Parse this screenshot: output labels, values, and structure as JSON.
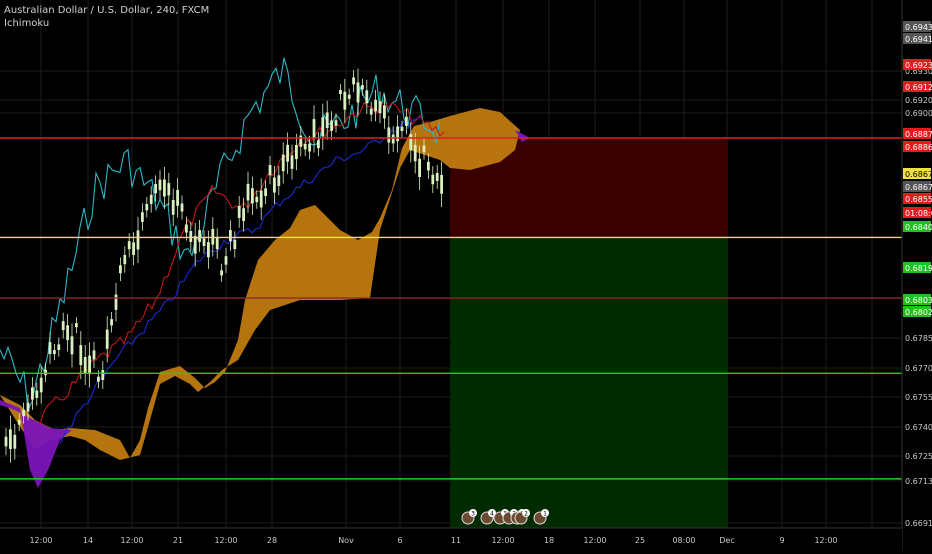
{
  "header": {
    "symbol_title": "Australian Dollar / U.S. Dollar, 240, FXCM",
    "indicator_label": "Ichimoku"
  },
  "colors": {
    "background": "#000000",
    "grid": "#1c1c1c",
    "text": "#c8c8c8",
    "candle": "#d8f0c0",
    "conversion_line": "#2ab8c8",
    "base_line": "#c01818",
    "lagging_span": "#1a2ad0",
    "cloud_bull": "#c07a10",
    "cloud_bear": "#7a14b8",
    "stop_zone": "#3a0000",
    "target_zone": "#002a00",
    "red_line": "#e02020",
    "yellow_line": "#f0e040",
    "dark_red_line": "#8a2a2a",
    "green_line": "#20d020"
  },
  "chart_data": {
    "type": "line",
    "title": "Australian Dollar / U.S. Dollar, 240, FXCM",
    "indicator": "Ichimoku",
    "x_tick_labels": [
      "12:00",
      "14",
      "12:00",
      "21",
      "12:00",
      "28",
      "Nov",
      "6",
      "11",
      "12:00",
      "18",
      "12:00",
      "25",
      "08:00",
      "Dec",
      "9",
      "12:00"
    ],
    "y_tick_labels": [
      "0.69300",
      "0.69200",
      "0.69000",
      "0.67850",
      "0.67700",
      "0.67550",
      "0.67400",
      "0.67250",
      "0.67130",
      "0.66910"
    ],
    "ylim": [
      0.6691,
      0.6945
    ],
    "price_labels": [
      {
        "value": "0.69433",
        "color": "#555555"
      },
      {
        "value": "0.69415",
        "color": "#555555"
      },
      {
        "value": "0.69231",
        "color": "#e01c1c"
      },
      {
        "value": "0.69125",
        "color": "#e01c1c"
      },
      {
        "value": "0.68874",
        "color": "#e01c1c"
      },
      {
        "value": "0.68863",
        "color": "#e01c1c"
      },
      {
        "value": "0.68677",
        "color": "#f0e040"
      },
      {
        "value": "0.68676",
        "color": "#555555"
      },
      {
        "value": "0.68557",
        "color": "#e01c1c"
      },
      {
        "value": "01:08:02",
        "color": "#e01c1c"
      },
      {
        "value": "0.68408",
        "color": "#20c020"
      },
      {
        "value": "0.68199",
        "color": "#20c020"
      },
      {
        "value": "0.68036",
        "color": "#20c020"
      },
      {
        "value": "0.68027",
        "color": "#20c020"
      }
    ],
    "horizontal_lines": [
      {
        "name": "stop",
        "value": 0.68874,
        "color": "#e02020"
      },
      {
        "name": "entry",
        "value": 0.68677,
        "color": "#f0e040"
      },
      {
        "name": "last",
        "value": 0.68557,
        "color": "#8a2a2a"
      },
      {
        "name": "tp1",
        "value": 0.68408,
        "color": "#20d020"
      },
      {
        "name": "tp2",
        "value": 0.68199,
        "color": "#20d020"
      },
      {
        "name": "tp3",
        "value": 0.68036,
        "color": "#20d020"
      }
    ],
    "position": {
      "entry": 0.68677,
      "stop": 0.68874,
      "target": 0.68036
    },
    "event_badges": [
      "3",
      "4",
      "3",
      "2",
      "1",
      "2",
      "1"
    ]
  }
}
